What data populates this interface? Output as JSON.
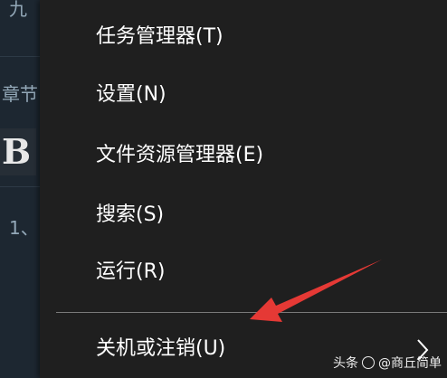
{
  "background": {
    "top_fragment": "九",
    "chapter_fragment": "章节",
    "bold_glyph": "B",
    "list_fragment": "1、"
  },
  "context_menu": {
    "items": [
      {
        "label": "任务管理器(T)"
      },
      {
        "label": "设置(N)"
      },
      {
        "label": "文件资源管理器(E)"
      },
      {
        "label": "搜索(S)"
      },
      {
        "label": "运行(R)"
      },
      {
        "label": "关机或注销(U)",
        "has_submenu": true
      }
    ]
  },
  "annotation": {
    "arrow_color": "#e53935",
    "points_to": "关机或注销(U)"
  },
  "watermark": {
    "source_label": "头条",
    "author": "@商丘简单"
  },
  "colors": {
    "menu_bg": "#1f1f1f",
    "menu_text": "#ffffff",
    "separator": "#7a7a7a"
  }
}
